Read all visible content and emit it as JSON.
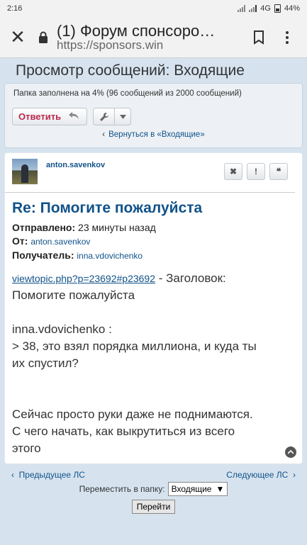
{
  "status_bar": {
    "time": "2:16",
    "network": "4G",
    "battery": "44%"
  },
  "browser": {
    "tab_title": "(1) Форум спонсоро…",
    "url": "https://sponsors.win"
  },
  "page": {
    "title": "Просмотр сообщений: Входящие",
    "folder_info": "Папка заполнена на 4% (96 сообщений из 2000 сообщений)",
    "reply_label": "Ответить",
    "back_link": "Вернуться в «Входящие»"
  },
  "post": {
    "author": "anton.savenkov",
    "title": "Re: Помогите пожалуйста",
    "sent_label": "Отправлено:",
    "sent_value": "23 минуты назад",
    "from_label": "От:",
    "from_value": "anton.savenkov",
    "to_label": "Получатель:",
    "to_value": "inna.vdovichenko",
    "link_text": "viewtopic.php?p=23692#p23692",
    "link_suffix": " - Заголовок:",
    "line2": "Помогите пожалуйста",
    "quote_author": "inna.vdovichenko :",
    "quote_line1": "> 38, это взял порядка миллиона, и куда ты",
    "quote_line2": "их спустил?",
    "body_line1": "Сейчас просто руки даже не поднимаются.",
    "body_line2": "С чего начать, как выкрутиться из всего",
    "body_line3": "этого"
  },
  "footer": {
    "prev": "Предыдущее ЛС",
    "next": "Следующее ЛС",
    "move_label": "Переместить в папку:",
    "folder_select": "Входящие",
    "go_label": "Перейти"
  },
  "icons": [
    "close-icon",
    "lock-icon",
    "bookmark-icon",
    "more-vert-icon",
    "reply-arrow-icon",
    "wrench-icon",
    "chevron-down-icon",
    "chevron-left-icon",
    "delete-x-icon",
    "report-icon",
    "quote-icon",
    "scroll-top-icon"
  ]
}
